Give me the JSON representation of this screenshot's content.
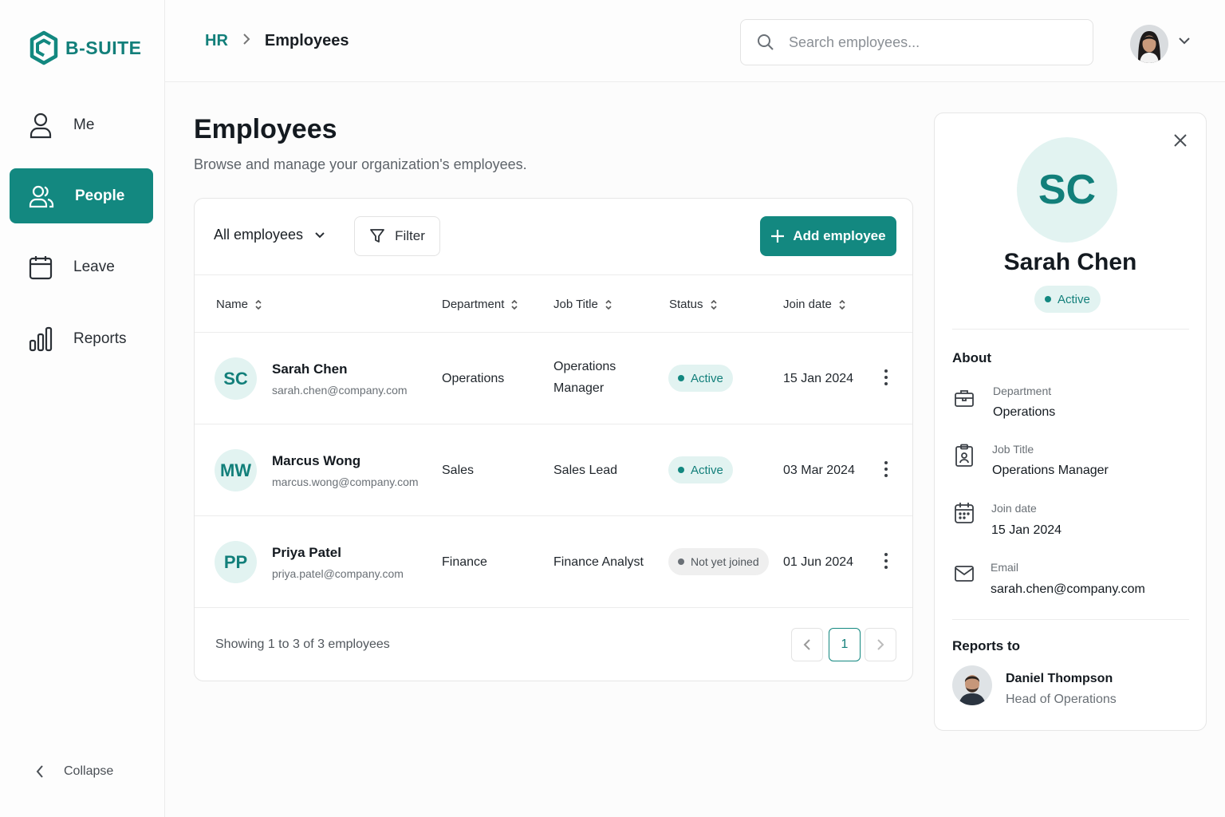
{
  "brand": {
    "name": "B-SUITE",
    "color": "#138880"
  },
  "sidebar": {
    "items": [
      {
        "label": "Me",
        "icon": "user-icon"
      },
      {
        "label": "People",
        "icon": "users-icon",
        "active": true
      },
      {
        "label": "Leave",
        "icon": "calendar-icon"
      },
      {
        "label": "Reports",
        "icon": "bar-chart-icon"
      }
    ],
    "collapse_label": "Collapse"
  },
  "topbar": {
    "breadcrumb": {
      "parent": "HR",
      "separator": ">",
      "current": "Employees"
    },
    "search": {
      "placeholder": "Search employees...",
      "value": ""
    }
  },
  "main": {
    "title": "Employees",
    "subtitle": "Browse and manage your organization's employees.",
    "view_select": "All employees",
    "filter_label": "Filter",
    "add_label": "Add employee",
    "columns": [
      "Name",
      "Department",
      "Job Title",
      "Status",
      "Join date"
    ],
    "rows": [
      {
        "initials": "SC",
        "name": "Sarah Chen",
        "email": "sarah.chen@company.com",
        "department": "Operations",
        "job_title_line1": "Operations",
        "job_title_line2": "Manager",
        "status": "Active",
        "status_type": "active",
        "join_date": "15 Jan 2024"
      },
      {
        "initials": "MW",
        "name": "Marcus Wong",
        "email": "marcus.wong@company.com",
        "department": "Sales",
        "job_title_line1": "Sales Lead",
        "job_title_line2": "",
        "status": "Active",
        "status_type": "active",
        "join_date": "03 Mar 2024"
      },
      {
        "initials": "PP",
        "name": "Priya Patel",
        "email": "priya.patel@company.com",
        "department": "Finance",
        "job_title_line1": "Finance Analyst",
        "job_title_line2": "",
        "status": "Not yet joined",
        "status_type": "pending",
        "join_date": "01 Jun 2024"
      }
    ],
    "footer": "Showing 1 to 3 of 3 employees",
    "current_page": "1"
  },
  "detail": {
    "initials": "SC",
    "name": "Sarah Chen",
    "status": "Active",
    "about_title": "About",
    "fields": [
      {
        "label": "Department",
        "value": "Operations",
        "icon": "briefcase-icon"
      },
      {
        "label": "Job Title",
        "value": "Operations Manager",
        "icon": "id-badge-icon"
      },
      {
        "label": "Join date",
        "value": "15 Jan 2024",
        "icon": "calendar-icon"
      },
      {
        "label": "Email",
        "value": "sarah.chen@company.com",
        "icon": "mail-icon"
      }
    ],
    "reports_to_title": "Reports to",
    "manager": {
      "name": "Daniel Thompson",
      "role": "Head of Operations"
    }
  }
}
